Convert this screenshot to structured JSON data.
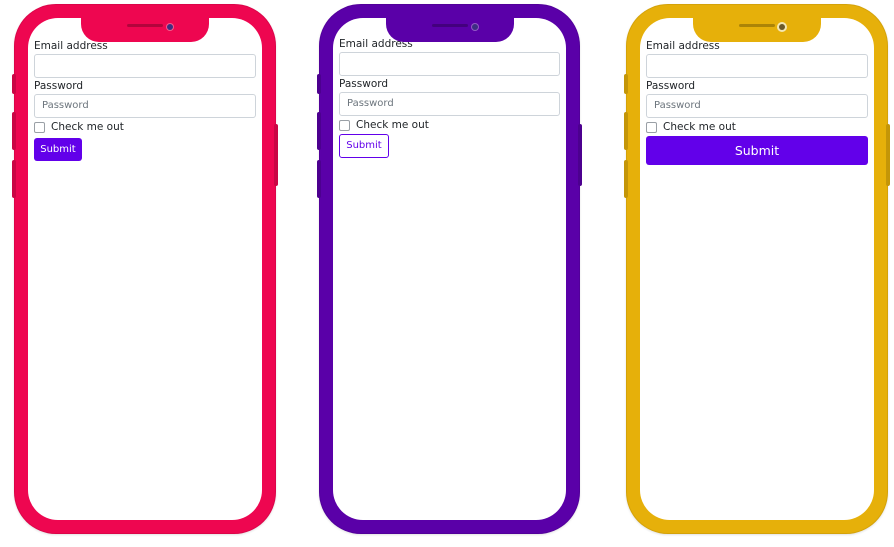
{
  "phones": [
    {
      "frame_color": "#ee0650",
      "email_label": "Email address",
      "email_value": "",
      "password_label": "Password",
      "password_placeholder": "Password",
      "checkbox_label": "Check me out",
      "submit_label": "Submit",
      "button_style": "solid",
      "button_color": "#6200ea"
    },
    {
      "frame_color": "#5a00a8",
      "email_label": "Email address",
      "email_value": "",
      "password_label": "Password",
      "password_placeholder": "Password",
      "checkbox_label": "Check me out",
      "submit_label": "Submit",
      "button_style": "outline",
      "button_color": "#6200ea"
    },
    {
      "frame_color": "#e6b00a",
      "email_label": "Email address",
      "email_value": "",
      "password_label": "Password",
      "password_placeholder": "Password",
      "checkbox_label": "Check me out",
      "submit_label": "Submit",
      "button_style": "solid-block",
      "button_color": "#6200ea"
    }
  ],
  "icons": {
    "camera": "camera-dot",
    "speaker": "speaker-slit"
  }
}
